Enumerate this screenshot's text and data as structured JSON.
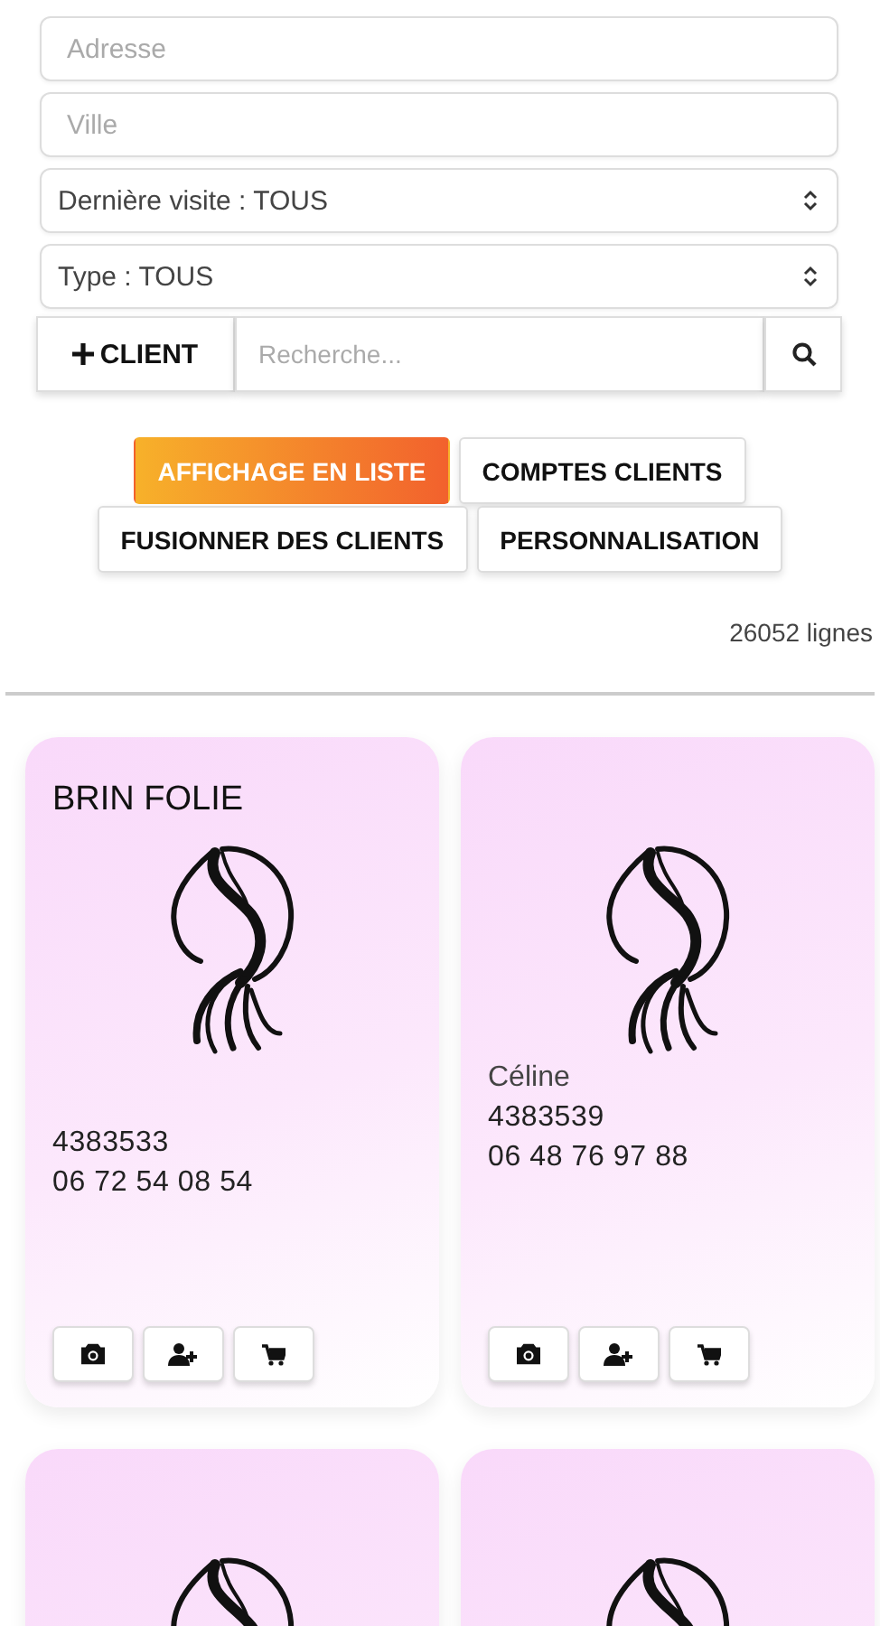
{
  "filters": [
    {
      "kind": "input",
      "placeholder": "Adresse"
    },
    {
      "kind": "input",
      "placeholder": "Ville"
    },
    {
      "kind": "select",
      "value": "Dernière visite : TOUS"
    },
    {
      "kind": "select",
      "value": "Type : TOUS"
    }
  ],
  "search": {
    "add_label": "CLIENT",
    "placeholder": "Recherche..."
  },
  "view_buttons": [
    {
      "label": "AFFICHAGE EN LISTE",
      "selected": true
    },
    {
      "label": "COMPTES CLIENTS",
      "selected": false
    },
    {
      "label": "FUSIONNER DES CLIENTS",
      "selected": false
    },
    {
      "label": "PERSONNALISATION",
      "selected": false
    }
  ],
  "row_count": "26052 lignes",
  "clients": [
    {
      "kind": "client",
      "title": "BRIN FOLIE",
      "code": "4383533",
      "phone": "06 72 54 08 54",
      "actions": [
        {
          "kind": "camera"
        },
        {
          "kind": "add-user"
        },
        {
          "kind": "cart"
        }
      ]
    },
    {
      "kind": "client",
      "subtitle": "Céline",
      "code": "4383539",
      "phone": "06 48 76 97 88",
      "actions": [
        {
          "kind": "camera"
        },
        {
          "kind": "add-user"
        },
        {
          "kind": "cart"
        }
      ]
    },
    {
      "kind": "client"
    },
    {
      "kind": "client"
    }
  ]
}
